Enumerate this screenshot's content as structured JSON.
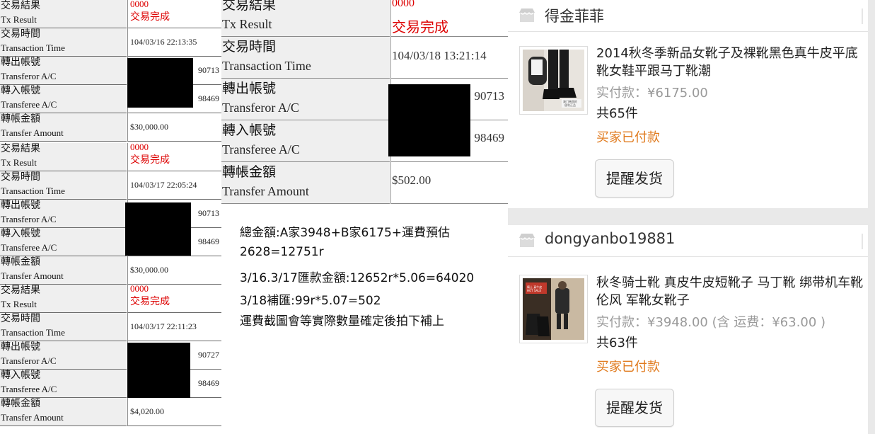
{
  "labels": {
    "tx_result_zh": "交易結果",
    "tx_result_en": "Tx Result",
    "tx_time_zh": "交易時間",
    "tx_time_en": "Transaction Time",
    "transferor_zh": "轉出帳號",
    "transferor_en": "Transferor A/C",
    "transferee_zh": "轉入帳號",
    "transferee_en": "Transferee A/C",
    "amount_zh": "轉帳金額",
    "amount_en": "Transfer Amount"
  },
  "receipts": [
    {
      "code": "0000",
      "status": "交易完成",
      "time": "104/03/16 22:13:35",
      "from_acc": "90713",
      "to_acc": "98469",
      "amount": "$30,000.00"
    },
    {
      "code": "0000",
      "status": "交易完成",
      "time": "104/03/17 22:05:24",
      "from_acc": "90713",
      "to_acc": "98469",
      "amount": "$30,000.00"
    },
    {
      "code": "0000",
      "status": "交易完成",
      "time": "104/03/17 22:11:23",
      "from_acc": "90727",
      "to_acc": "98469",
      "amount": "$4,020.00"
    },
    {
      "code": "0000",
      "status": "交易完成",
      "time": "104/03/18 13:21:14",
      "from_acc": "90713",
      "to_acc": "98469",
      "amount": "$502.00"
    }
  ],
  "notes": [
    "總金額:A家3948+B家6175+運費預估",
    "2628=12751r",
    "3/16.3/17匯款金額:12652r*5.06=64020",
    "3/18補匯:99r*5.07=502",
    "運費截圖會等實際數量確定後拍下補上"
  ],
  "shops": [
    {
      "name": "得金菲菲",
      "title_line1": "2014秋冬季新品女靴子及裸靴黑色真牛皮平底",
      "title_line2": "靴女鞋平跟马丁靴潮",
      "price": "实付款：¥6175.00",
      "qty": "共65件",
      "status": "买家已付款",
      "remind": "提醒发货"
    },
    {
      "name": "dongyanbo19881",
      "title_line1": "秋冬骑士靴 真皮牛皮短靴子 马丁靴 绑带机车靴",
      "title_line2": "伦风 军靴女靴子",
      "price": "实付款：¥3948.00 (含 运费：¥63.00 )",
      "qty": "共63件",
      "status": "买家已付款",
      "remind": "提醒发货"
    }
  ],
  "icons": {
    "shop": "shop-icon",
    "product": "product-photo"
  },
  "colors": {
    "status_red": "#dd0000",
    "paid_orange": "#e07b1f",
    "label_bg": "#efefef",
    "redaction": "#000000"
  }
}
